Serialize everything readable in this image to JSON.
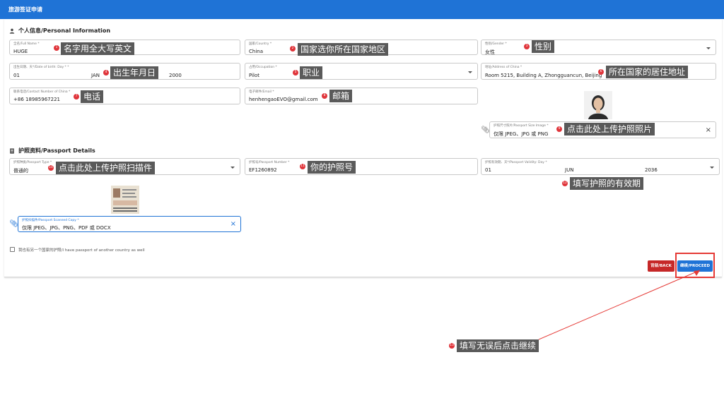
{
  "header": {
    "title": "旅游签证申请"
  },
  "personal": {
    "section_title": "个人信息/Personal Information",
    "full_name": {
      "label": "全名/Full Name *",
      "value": "HUGE",
      "dot": "1",
      "tip": "名字用全大写英文"
    },
    "country": {
      "label": "国家/Country *",
      "value": "China",
      "dot": "2",
      "tip": "国家选你所在国家地区"
    },
    "gender": {
      "label": "性别/Gender *",
      "value": "女性",
      "dot": "3",
      "tip": "性别"
    },
    "dob": {
      "label": "出生日期、天*/Date of birth: Day * *",
      "day": "01",
      "month": "JAN",
      "year": "2000",
      "dot": "4",
      "tip": "出生年月日"
    },
    "occupation": {
      "label": "占用/Occupation *",
      "value": "Pilot",
      "dot": "5",
      "tip": "职业"
    },
    "address": {
      "label": "地址/Address of China *",
      "value": "Room 5215, Building A, Zhongguancun, Beijing",
      "dot": "6",
      "tip": "所在国家的居住地址"
    },
    "contact": {
      "label": "联系电话/Contact Number of China *",
      "value": "+86 18985967221",
      "dot": "7",
      "tip": "电话"
    },
    "email": {
      "label": "电子邮件/Email *",
      "value": "henhengaoEVO@gmail.com",
      "dot": "8",
      "tip": "邮箱"
    },
    "photo": {
      "label": "护照尺寸照片/Passport Size Image *",
      "value": "仅限 JPEG、JPG 或 PNG",
      "dot": "9",
      "tip": "点击此处上传护照照片"
    }
  },
  "passport": {
    "section_title": "护照资料/Passport Details",
    "type": {
      "label": "护照种类/Passport Type *",
      "value": "普通的",
      "dot": "10",
      "tip": "点击此处上传护照扫描件"
    },
    "number": {
      "label": "护照号/Passport Number *",
      "value": "EF1260892",
      "dot": "11",
      "tip": "你的护照号"
    },
    "validity": {
      "label": "护照有效期、天*/Passport Validity: Day *",
      "day": "01",
      "month": "JUN",
      "year": "2036",
      "dot": "12",
      "tip": "填写护照的有效期"
    },
    "scan": {
      "label": "护照扫描件/Passport Scanned Copy *",
      "value": "仅限 JPEG、JPG、PNG、PDF 或 DOCX"
    },
    "another_checkbox": "我也有另一个国家的护照/I have passport of another country as well"
  },
  "buttons": {
    "back": "背部/BACK",
    "proceed": "继续/PROCEED"
  },
  "final_note": {
    "dot": "13",
    "tip": "填写无误后点击继续"
  },
  "colors": {
    "brand": "#1f73d6",
    "back": "#c62828",
    "annotation_dot": "#e0353b",
    "highlight": "#e53935"
  }
}
